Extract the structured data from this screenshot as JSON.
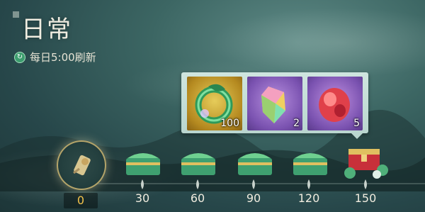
{
  "header": {
    "title": "日常",
    "refresh_text": "每日5:00刷新"
  },
  "progress": {
    "current": "0",
    "tiers": [
      "30",
      "60",
      "90",
      "120",
      "150"
    ]
  },
  "reward_popup": {
    "items": [
      {
        "name": "dragon-ring",
        "count": "100"
      },
      {
        "name": "purple-crystal",
        "count": "2"
      },
      {
        "name": "red-gem",
        "count": "5"
      }
    ]
  },
  "colors": {
    "accent_gold": "#f2c24b",
    "panel_bg": "#cfe5df"
  }
}
